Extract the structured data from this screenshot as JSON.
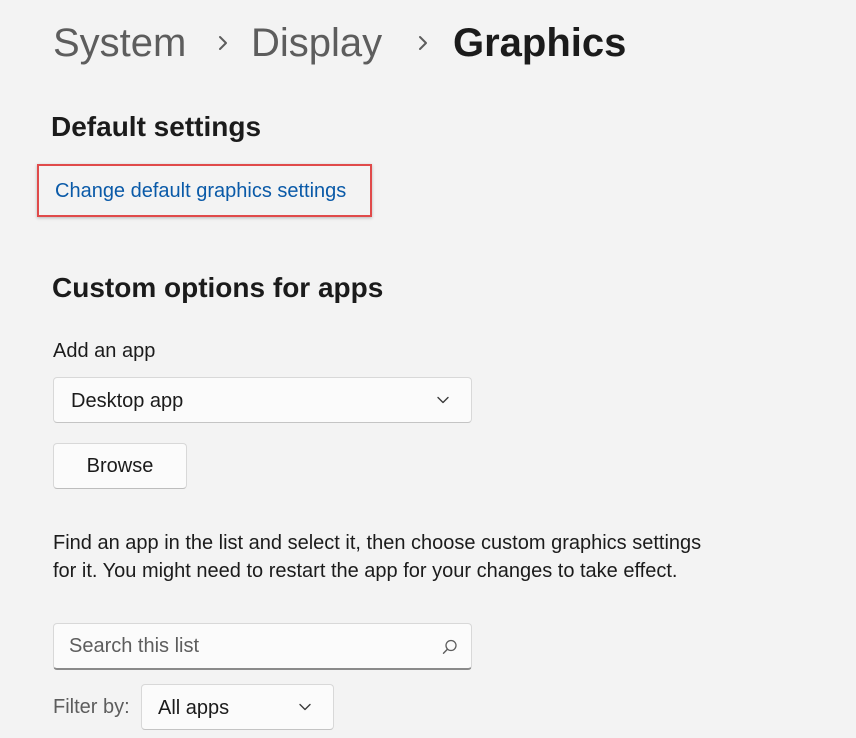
{
  "breadcrumb": {
    "items": [
      "System",
      "Display",
      "Graphics"
    ]
  },
  "default_settings": {
    "title": "Default settings",
    "link_label": "Change default graphics settings"
  },
  "custom_options": {
    "title": "Custom options for apps",
    "add_app_label": "Add an app",
    "app_type_selected": "Desktop app",
    "browse_label": "Browse",
    "description": "Find an app in the list and select it, then choose custom graphics settings for it. You might need to restart the app for your changes to take effect.",
    "search_placeholder": "Search this list",
    "filter_label": "Filter by:",
    "filter_selected": "All apps"
  },
  "colors": {
    "background": "#f3f3f3",
    "link": "#0a5aa8",
    "highlight_border": "#e04a4a",
    "muted_text": "#5d5d5d"
  },
  "icons": {
    "breadcrumb_separator": "chevron-right-icon",
    "dropdown": "chevron-down-icon",
    "search": "search-icon"
  }
}
